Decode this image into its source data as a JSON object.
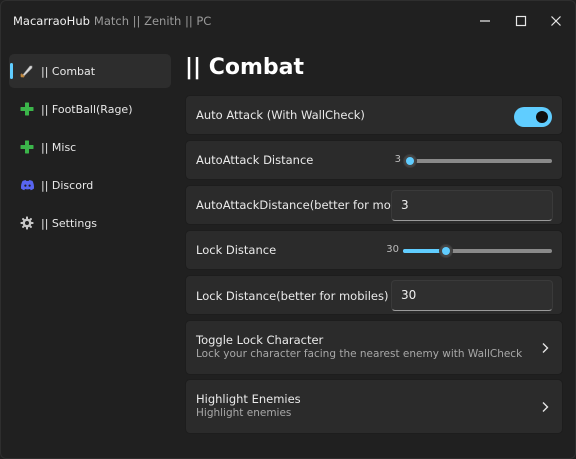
{
  "window": {
    "app_name": "MacarraoHub",
    "subtitle": "Match || Zenith || PC"
  },
  "sidebar": {
    "items": [
      {
        "label": "|| Combat",
        "icon": "sword-icon",
        "active": true
      },
      {
        "label": "|| FootBall(Rage)",
        "icon": "plus-icon"
      },
      {
        "label": "|| Misc",
        "icon": "plus-icon"
      },
      {
        "label": "|| Discord",
        "icon": "discord-icon"
      },
      {
        "label": "|| Settings",
        "icon": "gear-icon"
      }
    ]
  },
  "page": {
    "title": "|| Combat"
  },
  "settings": {
    "auto_attack": {
      "label": "Auto Attack (With WallCheck)",
      "enabled": true
    },
    "autoattack_distance": {
      "label": "AutoAttack Distance",
      "value": "3",
      "fraction": 0.03
    },
    "autoattack_distance_input": {
      "label": "AutoAttackDistance(better for mobiles)",
      "value": "3"
    },
    "lock_distance": {
      "label": "Lock Distance",
      "value": "30",
      "fraction": 0.29
    },
    "lock_distance_input": {
      "label": "Lock Distance(better for mobiles)",
      "value": "30"
    },
    "toggle_lock_character": {
      "label": "Toggle Lock Character",
      "description": "Lock your character facing the nearest enemy with WallCheck"
    },
    "highlight_enemies": {
      "label": "Highlight Enemies",
      "description": "Highlight enemies"
    }
  },
  "colors": {
    "accent": "#60cdff",
    "plus_icon": "#3bb54a",
    "discord_icon": "#5865f2"
  }
}
